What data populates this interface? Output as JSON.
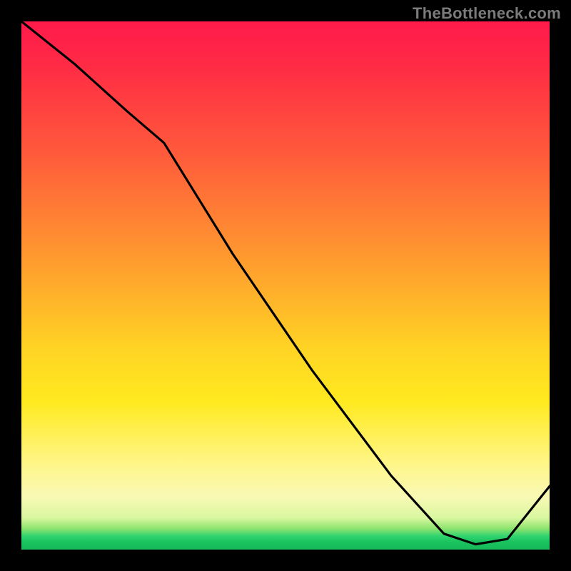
{
  "watermark": "TheBottleneck.com",
  "chart_data": {
    "type": "line",
    "title": "",
    "xlabel": "",
    "ylabel": "",
    "xlim": [
      0,
      100
    ],
    "ylim": [
      0,
      100
    ],
    "grid": false,
    "legend": false,
    "annotations": [
      {
        "text": "",
        "x": 80,
        "y": 2
      }
    ],
    "series": [
      {
        "name": "curve",
        "x": [
          0,
          10,
          20,
          27,
          40,
          55,
          70,
          80,
          86,
          92,
          100
        ],
        "y": [
          100,
          92,
          83,
          77,
          56,
          34,
          14,
          3,
          1,
          2,
          12
        ]
      }
    ],
    "background_gradient_stops": [
      {
        "pos": 0,
        "color": "#ff1a4b"
      },
      {
        "pos": 25,
        "color": "#ff5a3b"
      },
      {
        "pos": 52,
        "color": "#ffb22a"
      },
      {
        "pos": 72,
        "color": "#ffe91f"
      },
      {
        "pos": 90,
        "color": "#f9f9b5"
      },
      {
        "pos": 97.5,
        "color": "#2dd36f"
      },
      {
        "pos": 100,
        "color": "#17b85a"
      }
    ]
  },
  "label_near_minimum": ""
}
